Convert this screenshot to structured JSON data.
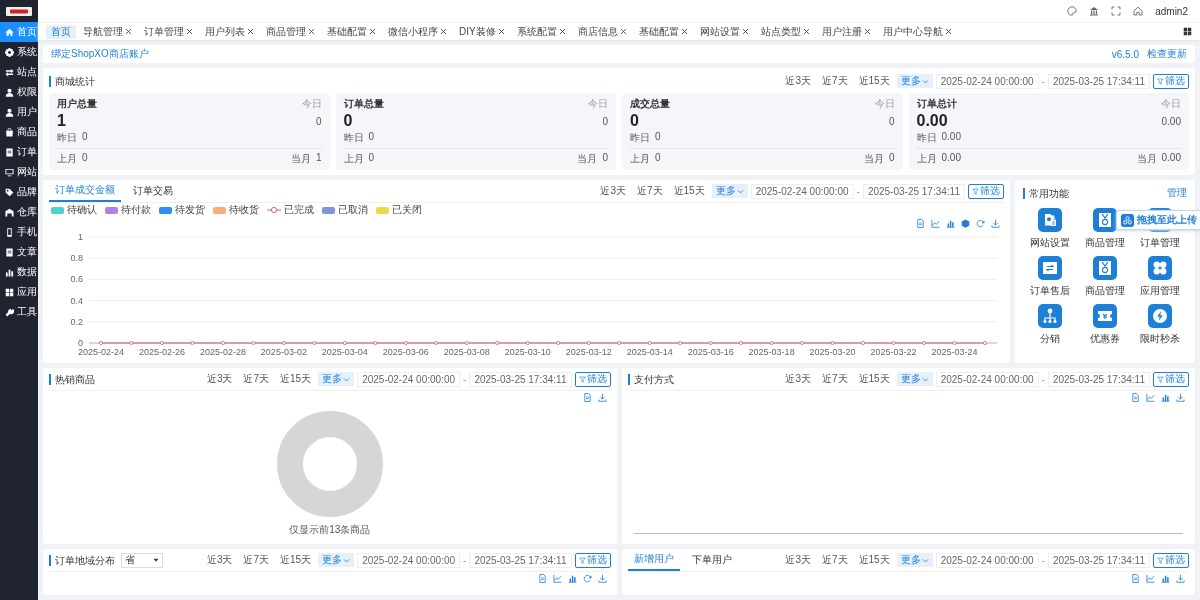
{
  "header": {
    "username": "admin2"
  },
  "sidebar": {
    "items": [
      {
        "label": "首页",
        "selected": true
      },
      {
        "label": "系统",
        "selected": false
      },
      {
        "label": "站点",
        "selected": false
      },
      {
        "label": "权限",
        "selected": false
      },
      {
        "label": "用户",
        "selected": false
      },
      {
        "label": "商品",
        "selected": false
      },
      {
        "label": "订单",
        "selected": false
      },
      {
        "label": "网站",
        "selected": false
      },
      {
        "label": "品牌",
        "selected": false
      },
      {
        "label": "仓库",
        "selected": false
      },
      {
        "label": "手机",
        "selected": false
      },
      {
        "label": "文章",
        "selected": false
      },
      {
        "label": "数据",
        "selected": false
      },
      {
        "label": "应用",
        "selected": false
      },
      {
        "label": "工具",
        "selected": false
      }
    ]
  },
  "tabs": [
    {
      "label": "首页",
      "selected": true,
      "closable": false
    },
    {
      "label": "导航管理",
      "selected": false,
      "closable": true
    },
    {
      "label": "订单管理",
      "selected": false,
      "closable": true
    },
    {
      "label": "用户列表",
      "selected": false,
      "closable": true
    },
    {
      "label": "商品管理",
      "selected": false,
      "closable": true
    },
    {
      "label": "基础配置",
      "selected": false,
      "closable": true
    },
    {
      "label": "微信小程序",
      "selected": false,
      "closable": true
    },
    {
      "label": "DIY装修",
      "selected": false,
      "closable": true
    },
    {
      "label": "系统配置",
      "selected": false,
      "closable": true
    },
    {
      "label": "商店信息",
      "selected": false,
      "closable": true
    },
    {
      "label": "基础配置",
      "selected": false,
      "closable": true
    },
    {
      "label": "网站设置",
      "selected": false,
      "closable": true
    },
    {
      "label": "站点类型",
      "selected": false,
      "closable": true
    },
    {
      "label": "用户注册",
      "selected": false,
      "closable": true
    },
    {
      "label": "用户中心导航",
      "selected": false,
      "closable": true
    }
  ],
  "notice": {
    "link": "绑定ShopXO商店账户",
    "version": "v6.5.0",
    "update": "检查更新"
  },
  "mall_stats": {
    "title": "商城统计",
    "filter": {
      "periods": [
        {
          "label": "近3天",
          "kind": "preset",
          "selected": false
        },
        {
          "label": "近7天",
          "kind": "preset",
          "selected": false
        },
        {
          "label": "近15天",
          "kind": "preset",
          "selected": false
        },
        {
          "label": "更多",
          "kind": "dropdown",
          "selected": true
        }
      ],
      "start": "2025-02-24 00:00:00",
      "separator": "-",
      "end": "2025-03-25 17:34:11",
      "button": "筛选"
    },
    "cards": [
      {
        "title": "用户总量",
        "total": "1",
        "today_label": "今日",
        "today": "0",
        "yesterday_label": "昨日",
        "yesterday": "0",
        "last_month_label": "上月",
        "last_month": "0",
        "this_month_label": "当月",
        "this_month": "1"
      },
      {
        "title": "订单总量",
        "total": "0",
        "today_label": "今日",
        "today": "0",
        "yesterday_label": "昨日",
        "yesterday": "0",
        "last_month_label": "上月",
        "last_month": "0",
        "this_month_label": "当月",
        "this_month": "0"
      },
      {
        "title": "成交总量",
        "total": "0",
        "today_label": "今日",
        "today": "0",
        "yesterday_label": "昨日",
        "yesterday": "0",
        "last_month_label": "上月",
        "last_month": "0",
        "this_month_label": "当月",
        "this_month": "0"
      },
      {
        "title": "订单总计",
        "total": "0.00",
        "today_label": "今日",
        "today": "0.00",
        "yesterday_label": "昨日",
        "yesterday": "0.00",
        "last_month_label": "上月",
        "last_month": "0.00",
        "this_month_label": "当月",
        "this_month": "0.00"
      }
    ]
  },
  "order_chart": {
    "tabs": [
      {
        "label": "订单成交金额",
        "selected": true
      },
      {
        "label": "订单交易",
        "selected": false
      }
    ],
    "filter": {
      "periods": [
        {
          "label": "近3天",
          "kind": "preset",
          "selected": false
        },
        {
          "label": "近7天",
          "kind": "preset",
          "selected": false
        },
        {
          "label": "近15天",
          "kind": "preset",
          "selected": false
        },
        {
          "label": "更多",
          "kind": "dropdown",
          "selected": true
        }
      ],
      "start": "2025-02-24 00:00:00",
      "separator": "-",
      "end": "2025-03-25 17:34:11",
      "button": "筛选"
    },
    "chart_data": {
      "type": "line",
      "grid": true,
      "ylim": [
        0,
        1
      ],
      "yticks": [
        0,
        0.2,
        0.4,
        0.6,
        0.8,
        1
      ],
      "categories": [
        "2025-02-24",
        null,
        "2025-02-26",
        null,
        "2025-02-28",
        null,
        "2025-03-02",
        null,
        "2025-03-04",
        null,
        "2025-03-06",
        null,
        "2025-03-08",
        null,
        "2025-03-10",
        null,
        "2025-03-12",
        null,
        "2025-03-14",
        null,
        "2025-03-16",
        null,
        "2025-03-18",
        null,
        "2025-03-20",
        null,
        "2025-03-22",
        null,
        "2025-03-24",
        null
      ],
      "series": [
        {
          "name": "待确认",
          "color": "#4fd1d0",
          "marker": false,
          "values": [
            null,
            null,
            null,
            null,
            null,
            null,
            null,
            null,
            null,
            null,
            null,
            null,
            null,
            null,
            null,
            null,
            null,
            null,
            null,
            null,
            null,
            null,
            null,
            null,
            null,
            null,
            null,
            null,
            null,
            null
          ]
        },
        {
          "name": "待付款",
          "color": "#a985e6",
          "marker": false,
          "values": [
            null,
            null,
            null,
            null,
            null,
            null,
            null,
            null,
            null,
            null,
            null,
            null,
            null,
            null,
            null,
            null,
            null,
            null,
            null,
            null,
            null,
            null,
            null,
            null,
            null,
            null,
            null,
            null,
            null,
            null
          ]
        },
        {
          "name": "待发货",
          "color": "#2f8ef0",
          "marker": false,
          "values": [
            null,
            null,
            null,
            null,
            null,
            null,
            null,
            null,
            null,
            null,
            null,
            null,
            null,
            null,
            null,
            null,
            null,
            null,
            null,
            null,
            null,
            null,
            null,
            null,
            null,
            null,
            null,
            null,
            null,
            null
          ]
        },
        {
          "name": "待收货",
          "color": "#f7ad7e",
          "marker": false,
          "values": [
            null,
            null,
            null,
            null,
            null,
            null,
            null,
            null,
            null,
            null,
            null,
            null,
            null,
            null,
            null,
            null,
            null,
            null,
            null,
            null,
            null,
            null,
            null,
            null,
            null,
            null,
            null,
            null,
            null,
            null
          ]
        },
        {
          "name": "已完成",
          "color": "#d9626c",
          "marker": true,
          "values": [
            0,
            0,
            0,
            0,
            0,
            0,
            0,
            0,
            0,
            0,
            0,
            0,
            0,
            0,
            0,
            0,
            0,
            0,
            0,
            0,
            0,
            0,
            0,
            0,
            0,
            0,
            0,
            0,
            0,
            0
          ]
        },
        {
          "name": "已取消",
          "color": "#7f97da",
          "marker": false,
          "values": [
            null,
            null,
            null,
            null,
            null,
            null,
            null,
            null,
            null,
            null,
            null,
            null,
            null,
            null,
            null,
            null,
            null,
            null,
            null,
            null,
            null,
            null,
            null,
            null,
            null,
            null,
            null,
            null,
            null,
            null
          ]
        },
        {
          "name": "已关闭",
          "color": "#eed84a",
          "marker": false,
          "values": [
            null,
            null,
            null,
            null,
            null,
            null,
            null,
            null,
            null,
            null,
            null,
            null,
            null,
            null,
            null,
            null,
            null,
            null,
            null,
            null,
            null,
            null,
            null,
            null,
            null,
            null,
            null,
            null,
            null,
            null
          ]
        }
      ]
    }
  },
  "shortcuts": {
    "title": "常用功能",
    "manage": "管理",
    "items": [
      {
        "label": "网站设置"
      },
      {
        "label": "商品管理"
      },
      {
        "label": "订单管理"
      },
      {
        "label": "订单售后"
      },
      {
        "label": "商品管理"
      },
      {
        "label": "应用管理"
      },
      {
        "label": "分销"
      },
      {
        "label": "优惠券"
      },
      {
        "label": "限时秒杀"
      }
    ]
  },
  "upload_badge": {
    "label": "拖拽至此上传"
  },
  "hot_goods": {
    "title": "热销商品",
    "filter": {
      "periods": [
        {
          "label": "近3天",
          "kind": "preset",
          "selected": false
        },
        {
          "label": "近7天",
          "kind": "preset",
          "selected": false
        },
        {
          "label": "近15天",
          "kind": "preset",
          "selected": false
        },
        {
          "label": "更多",
          "kind": "dropdown",
          "selected": true
        }
      ],
      "start": "2025-02-24 00:00:00",
      "separator": "-",
      "end": "2025-03-25 17:34:11",
      "button": "筛选"
    },
    "note": "仅显示前13条商品"
  },
  "payment": {
    "title": "支付方式",
    "filter": {
      "periods": [
        {
          "label": "近3天",
          "kind": "preset",
          "selected": false
        },
        {
          "label": "近7天",
          "kind": "preset",
          "selected": false
        },
        {
          "label": "近15天",
          "kind": "preset",
          "selected": false
        },
        {
          "label": "更多",
          "kind": "dropdown",
          "selected": true
        }
      ],
      "start": "2025-02-24 00:00:00",
      "separator": "-",
      "end": "2025-03-25 17:34:11",
      "button": "筛选"
    }
  },
  "region": {
    "title": "订单地域分布",
    "select": "省",
    "filter": {
      "periods": [
        {
          "label": "近3天",
          "kind": "preset",
          "selected": false
        },
        {
          "label": "近7天",
          "kind": "preset",
          "selected": false
        },
        {
          "label": "近15天",
          "kind": "preset",
          "selected": false
        },
        {
          "label": "更多",
          "kind": "dropdown",
          "selected": true
        }
      ],
      "start": "2025-02-24 00:00:00",
      "separator": "-",
      "end": "2025-03-25 17:34:11",
      "button": "筛选"
    }
  },
  "users": {
    "tabs": [
      {
        "label": "新增用户",
        "selected": true
      },
      {
        "label": "下单用户",
        "selected": false
      }
    ],
    "filter": {
      "periods": [
        {
          "label": "近3天",
          "kind": "preset",
          "selected": false
        },
        {
          "label": "近7天",
          "kind": "preset",
          "selected": false
        },
        {
          "label": "近15天",
          "kind": "preset",
          "selected": false
        },
        {
          "label": "更多",
          "kind": "dropdown",
          "selected": true
        }
      ],
      "start": "2025-02-24 00:00:00",
      "separator": "-",
      "end": "2025-03-25 17:34:11",
      "button": "筛选"
    }
  }
}
